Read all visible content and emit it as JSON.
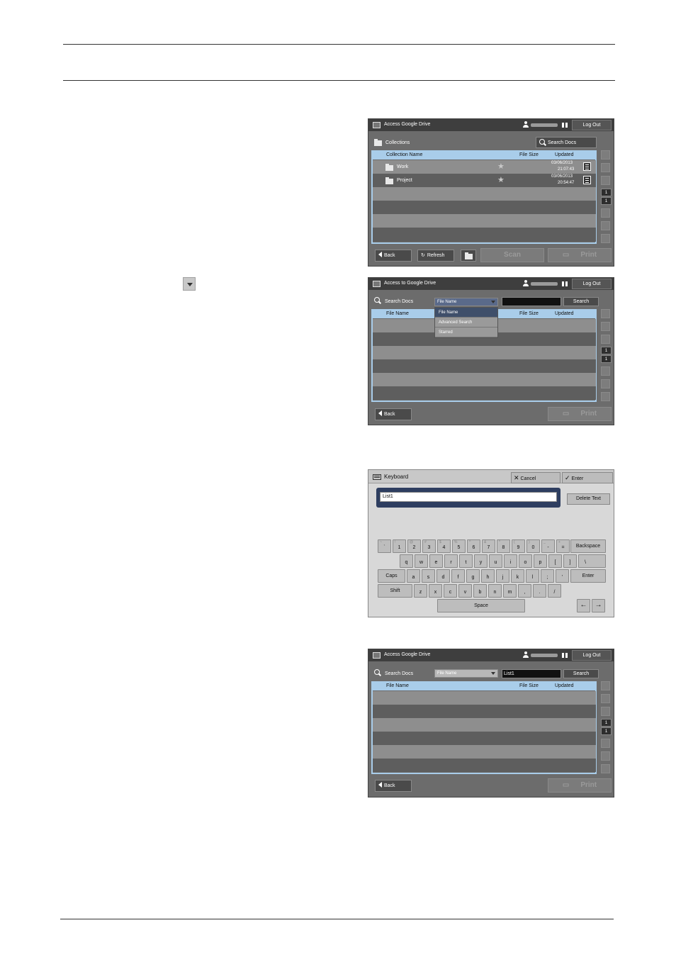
{
  "screen1": {
    "title": "Access Google Drive",
    "logout": "Log Out",
    "collections": "Collections",
    "search_docs": "Search Docs",
    "columns": [
      "Collection Name",
      "File Size",
      "Updated"
    ],
    "rows": [
      {
        "name": "Work",
        "date": "03/06/2013",
        "time": "21:07:43"
      },
      {
        "name": "Project",
        "date": "03/06/2013",
        "time": "20:54:47"
      }
    ],
    "page_current": "1",
    "page_total": "1",
    "back": "Back",
    "refresh": "Refresh",
    "scan": "Scan",
    "print": "Print"
  },
  "screen2": {
    "title": "Access to Google Drive",
    "logout": "Log Out",
    "search_docs": "Search Docs",
    "select_value": "File Name",
    "search_button": "Search",
    "columns": [
      "File Name",
      "File Size",
      "Updated"
    ],
    "menu_items": [
      "File Name",
      "Advanced Search",
      "Starred"
    ],
    "page_current": "1",
    "page_total": "1",
    "back": "Back",
    "print": "Print"
  },
  "keyboard": {
    "title": "Keyboard",
    "cancel": "Cancel",
    "enter_top": "Enter",
    "input_value": "List1",
    "delete_text": "Delete Text",
    "row1": [
      "`",
      "1",
      "2",
      "3",
      "4",
      "5",
      "6",
      "7",
      "8",
      "9",
      "0",
      "-",
      "="
    ],
    "row1_shift": [
      "~",
      "!",
      "@",
      "#",
      "$",
      "%",
      "^",
      "&",
      "*",
      "(",
      ")",
      "_",
      "+"
    ],
    "backspace": "Backspace",
    "row2": [
      "q",
      "w",
      "e",
      "r",
      "t",
      "y",
      "u",
      "i",
      "o",
      "p",
      "[",
      "]",
      "\\"
    ],
    "caps": "Caps",
    "row3": [
      "a",
      "s",
      "d",
      "f",
      "g",
      "h",
      "j",
      "k",
      "l",
      ";",
      "'"
    ],
    "enter": "Enter",
    "shift": "Shift",
    "row4": [
      "z",
      "x",
      "c",
      "v",
      "b",
      "n",
      "m",
      ",",
      ".",
      "/"
    ],
    "space": "Space",
    "left_arrow": "←",
    "right_arrow": "→"
  },
  "screen4": {
    "title": "Access Google Drive",
    "logout": "Log Out",
    "search_docs": "Search Docs",
    "select_value": "File Name",
    "search_value": "List1",
    "search_button": "Search",
    "columns": [
      "File Name",
      "File Size",
      "Updated"
    ],
    "page_current": "1",
    "page_total": "1",
    "back": "Back",
    "print": "Print"
  }
}
